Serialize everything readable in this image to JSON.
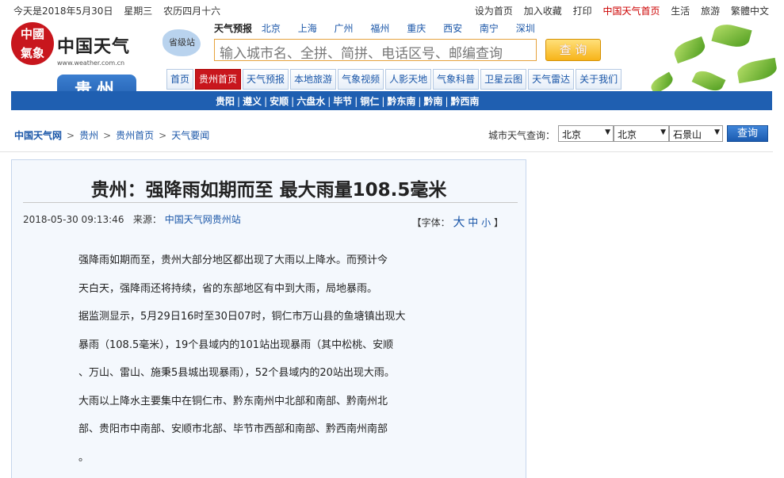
{
  "topbar": {
    "date": "今天是2018年5月30日",
    "weekday": "星期三",
    "lunar": "农历四月十六",
    "links": [
      {
        "label": "设为首页",
        "red": false
      },
      {
        "label": "加入收藏",
        "red": false
      },
      {
        "label": "打印",
        "red": false
      },
      {
        "label": "中国天气首页",
        "red": true
      },
      {
        "label": "生活",
        "red": false
      },
      {
        "label": "旅游",
        "red": false
      },
      {
        "label": "繁體中文",
        "red": false
      }
    ]
  },
  "logo": {
    "seal_text_1": "中國",
    "seal_text_2": "氣象",
    "name": "中国天气",
    "url": "www.weather.com.cn"
  },
  "province_map_label": "省级站",
  "forecast": {
    "head": "天气预报",
    "cities": [
      "北京",
      "上海",
      "广州",
      "福州",
      "重庆",
      "西安",
      "南宁",
      "深圳"
    ]
  },
  "search": {
    "placeholder": "输入城市名、全拼、简拼、电话区号、邮编查询",
    "button": "查 询"
  },
  "province": "贵州",
  "nav": [
    "首页",
    "贵州首页",
    "天气预报",
    "本地旅游",
    "气象视频",
    "人影天地",
    "气象科普",
    "卫星云图",
    "天气雷达",
    "关于我们"
  ],
  "nav_active_index": 1,
  "cities_bar": [
    "贵阳",
    "遵义",
    "安顺",
    "六盘水",
    "毕节",
    "铜仁",
    "黔东南",
    "黔南",
    "黔西南"
  ],
  "breadcrumb": [
    "中国天气网",
    "贵州",
    "贵州首页",
    "天气要闻"
  ],
  "city_query": {
    "label": "城市天气查询：",
    "province": "北京",
    "city": "北京",
    "district": "石景山",
    "button": "查询"
  },
  "article": {
    "title": "贵州：强降雨如期而至 最大雨量108.5毫米",
    "datetime": "2018-05-30 09:13:46",
    "source_label": "来源：",
    "source": "中国天气网贵州站",
    "font_label_open": "【字体：",
    "font_big": "大",
    "font_mid": "中",
    "font_small": "小",
    "font_label_close": "】",
    "lines": [
      "强降雨如期而至，贵州大部分地区都出现了大雨以上降水。而预计今",
      "天白天，强降雨还将持续，省的东部地区有中到大雨，局地暴雨。",
      "据监测显示，5月29日16时至30日07时，铜仁市万山县的鱼塘镇出现大",
      "暴雨（108.5毫米），19个县域内的101站出现暴雨（其中松桃、安顺",
      "、万山、雷山、施秉5县城出现暴雨），52个县域内的20站出现大雨。",
      "大雨以上降水主要集中在铜仁市、黔东南州中北部和南部、黔南州北",
      "部、贵阳市中南部、安顺市北部、毕节市西部和南部、黔西南州南部",
      "。"
    ]
  }
}
